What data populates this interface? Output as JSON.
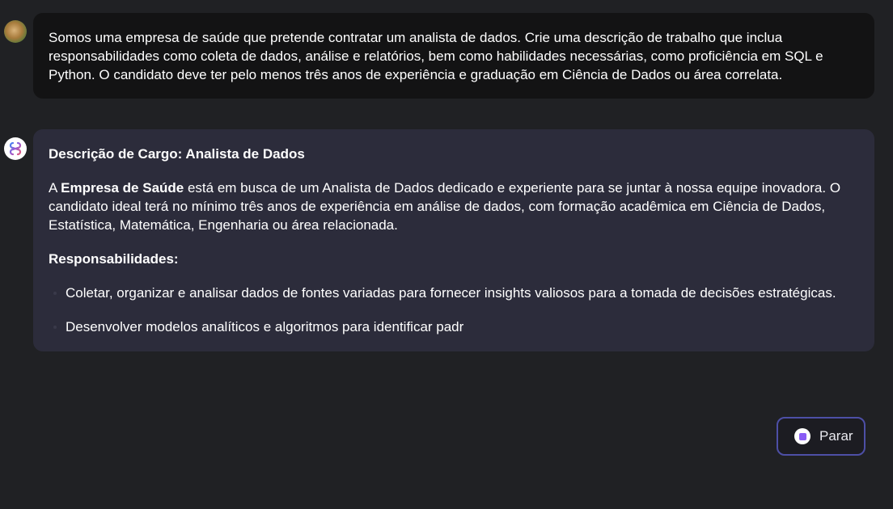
{
  "user_message": {
    "text": "Somos uma empresa de saúde que pretende contratar um analista de dados. Crie uma descrição de trabalho que inclua responsabilidades como coleta de dados, análise e relatórios, bem como habilidades necessárias, como proficiência em SQL e Python. O candidato deve ter pelo menos três anos de experiência e graduação em Ciência de Dados ou área correlata."
  },
  "assistant_message": {
    "title": "Descrição de Cargo: Analista de Dados",
    "intro_prefix": "A ",
    "intro_bold": "Empresa de Saúde",
    "intro_rest": " está em busca de um Analista de Dados dedicado e experiente para se juntar à nossa equipe inovadora. O candidato ideal terá no mínimo três anos de experiência em análise de dados, com formação acadêmica em Ciência de Dados, Estatística, Matemática, Engenharia ou área relacionada.",
    "section_title": "Responsabilidades:",
    "bullets": [
      "Coletar, organizar e analisar dados de fontes variadas para fornecer insights valiosos para a tomada de decisões estratégicas.",
      "Desenvolver modelos analíticos e algoritmos para identificar padr"
    ]
  },
  "stop_button": {
    "label": "Parar"
  },
  "colors": {
    "background": "#202124",
    "user_bubble": "#131314",
    "assistant_bubble": "#2c2c3b",
    "stop_border": "#4d4fa6",
    "stop_icon_accent": "#8a5cf5"
  },
  "icons": {
    "user_avatar": "user-avatar",
    "assistant_avatar": "assistant-logo-icon",
    "stop": "stop-icon"
  }
}
